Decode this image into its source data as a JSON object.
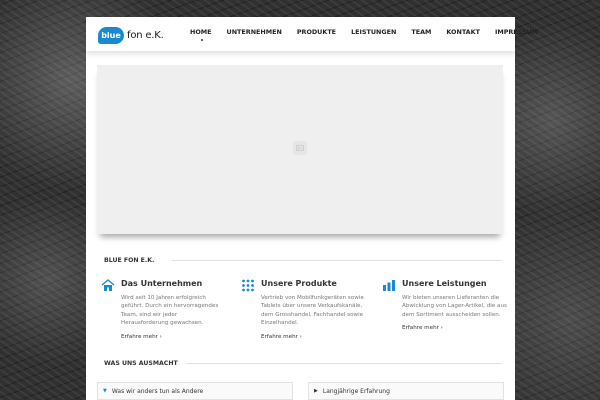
{
  "brand": {
    "mark": "blue",
    "name": "fon e.K."
  },
  "nav": {
    "items": [
      "HOME",
      "UNTERNEHMEN",
      "PRODUKTE",
      "LEISTUNGEN",
      "TEAM",
      "KONTAKT",
      "IMPRESSUM"
    ]
  },
  "sections": {
    "company": "BLUE FON E.K.",
    "values": "WAS UNS AUSMACHT"
  },
  "columns": [
    {
      "title": "Das Unternehmen",
      "text": "Wird seit 10 Jahren erfolgreich geführt. Durch ein hervorragendes Team, sind wir jeder Herausforderung gewachsen.",
      "link": "Erfahre mehr ›"
    },
    {
      "title": "Unsere Produkte",
      "text": "Vertrieb von Mobilfunkgeräten sowie Tablets über unsere Verkaufskanäle, dem Grosshandel, Fachhandel sowie Einzelhandel.",
      "link": "Erfahre mehr ›"
    },
    {
      "title": "Unsere Leistungen",
      "text": "Wir bieten unseren Lieferanten die Abwicklung von Lager-Artikel, die aus dem Sortiment ausscheiden sollen.",
      "link": "Erfahre mehr ›"
    }
  ],
  "accordion": [
    {
      "label": "Was wir anders tun als Andere",
      "open": true
    },
    {
      "label": "Langjährige Erfahrung",
      "open": false
    }
  ],
  "icons": {
    "slider": "image-placeholder-icon",
    "col1": "house-icon",
    "col2": "grid-icon",
    "col3": "bar-chart-icon"
  },
  "colors": {
    "accent": "#1a8ad0",
    "text": "#333333",
    "muted": "#777777"
  }
}
